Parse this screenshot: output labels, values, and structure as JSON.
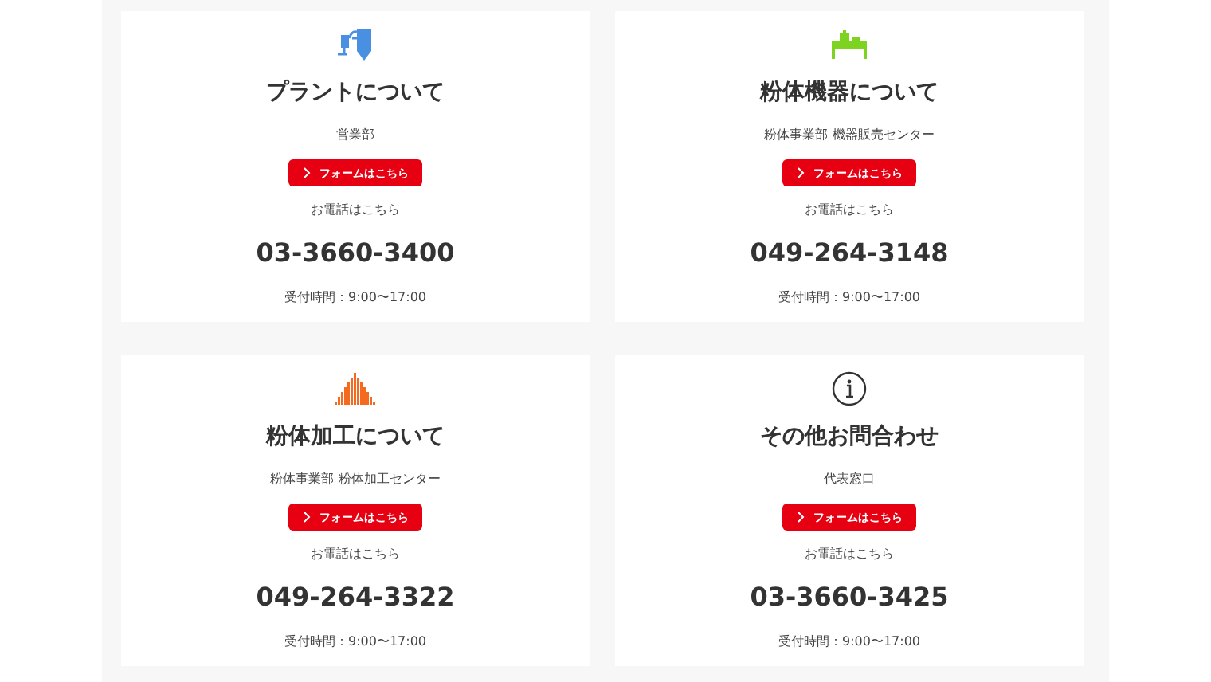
{
  "cards": [
    {
      "kind": "plant",
      "title": "プラントについて",
      "department": "営業部",
      "button": "フォームはこちら",
      "phone_label": "お電話はこちら",
      "phone": "03-3660-3400",
      "hours": "受付時間：9:00〜17:00"
    },
    {
      "kind": "machine",
      "title": "粉体機器について",
      "department": "粉体事業部 機器販売センター",
      "button": "フォームはこちら",
      "phone_label": "お電話はこちら",
      "phone": "049-264-3148",
      "hours": "受付時間：9:00〜17:00"
    },
    {
      "kind": "histogram",
      "title": "粉体加工について",
      "department": "粉体事業部 粉体加工センター",
      "button": "フォームはこちら",
      "phone_label": "お電話はこちら",
      "phone": "049-264-3322",
      "hours": "受付時間：9:00〜17:00"
    },
    {
      "kind": "info",
      "title": "その他お問合わせ",
      "department": "代表窓口",
      "button": "フォームはこちら",
      "phone_label": "お電話はこちら",
      "phone": "03-3660-3425",
      "hours": "受付時間：9:00〜17:00"
    }
  ]
}
